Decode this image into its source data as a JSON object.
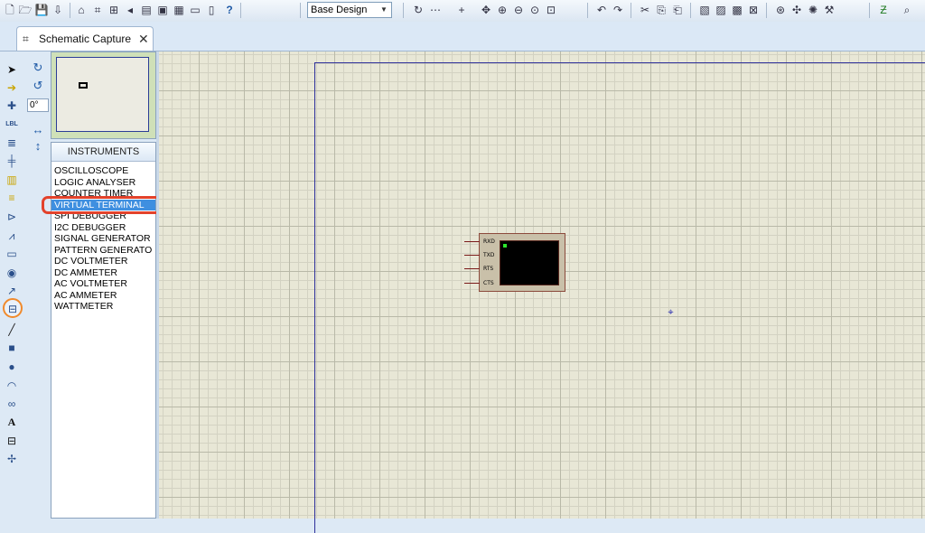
{
  "toolbar": {
    "design_select": "Base Design",
    "icons": [
      "new-file-icon",
      "open-folder-icon",
      "save-icon",
      "import-icon",
      "home-icon",
      "schematic-icon",
      "pcb-icon",
      "gerber-icon",
      "bom-icon",
      "design-explorer-icon",
      "pcb-layout-icon",
      "notes-icon",
      "document-icon",
      "help-icon",
      "refresh-icon",
      "grid-toggle-icon",
      "origin-icon",
      "pan-icon",
      "zoom-in-icon",
      "zoom-out-icon",
      "zoom-all-icon",
      "zoom-area-icon",
      "undo-icon",
      "redo-icon",
      "cut-icon",
      "copy-icon",
      "paste-icon",
      "block-copy-icon",
      "block-move-icon",
      "block-rotate-icon",
      "block-delete-icon",
      "pick-device-icon",
      "make-device-icon",
      "packaging-tool-icon",
      "decompose-icon",
      "wire-autorouter-icon",
      "search-icon"
    ]
  },
  "tab": {
    "label": "Schematic Capture"
  },
  "rotation": {
    "angle": "0°"
  },
  "instruments": {
    "header": "INSTRUMENTS",
    "items": [
      "OSCILLOSCOPE",
      "LOGIC ANALYSER",
      "COUNTER TIMER",
      "VIRTUAL TERMINAL",
      "SPI DEBUGGER",
      "I2C DEBUGGER",
      "SIGNAL GENERATOR",
      "PATTERN GENERATO",
      "DC VOLTMETER",
      "DC AMMETER",
      "AC VOLTMETER",
      "AC AMMETER",
      "WATTMETER"
    ],
    "selected": "VIRTUAL TERMINAL"
  },
  "component": {
    "pins": [
      "RXD",
      "TXD",
      "RTS",
      "CTS"
    ]
  },
  "colors": {
    "highlight_ring": "#e3422b",
    "tool_ring": "#f08a2c",
    "sheet_border": "#2d2f9a",
    "canvas": "#e8e7d6",
    "selection": "#3f8fe0"
  }
}
